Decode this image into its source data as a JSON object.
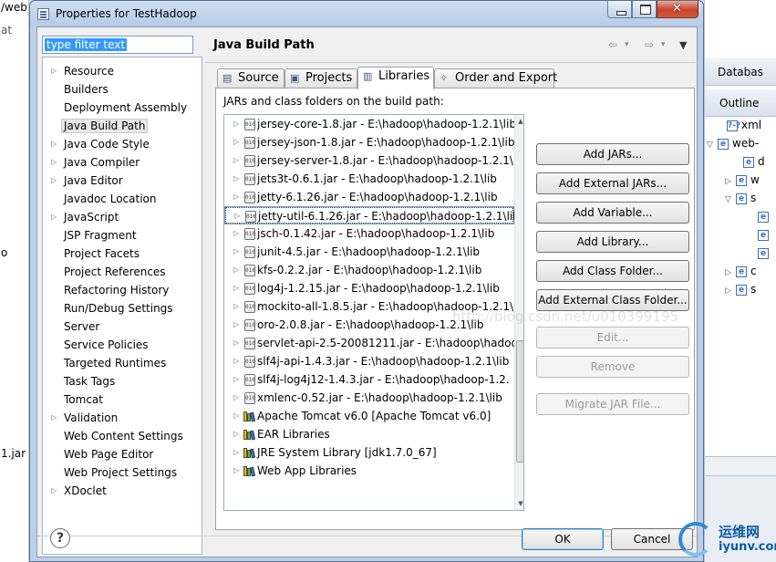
{
  "background": {
    "left_texts": [
      "/web",
      "at",
      "o",
      "1.jar"
    ],
    "right": {
      "databases_tab": "Databas",
      "outline_tab": "Outline",
      "outline_rows": [
        {
          "twisty": "",
          "icon": "?-?",
          "label": "xml"
        },
        {
          "twisty": "▽",
          "icon": "e",
          "label": "web-"
        },
        {
          "twisty": "",
          "icon": "e",
          "label": "d"
        },
        {
          "twisty": "▷",
          "icon": "e",
          "label": "w"
        },
        {
          "twisty": "▽",
          "icon": "e",
          "label": "s"
        },
        {
          "twisty": "",
          "icon": "e",
          "label": ""
        },
        {
          "twisty": "",
          "icon": "e",
          "label": ""
        },
        {
          "twisty": "",
          "icon": "e",
          "label": ""
        },
        {
          "twisty": "▷",
          "icon": "e",
          "label": "c"
        },
        {
          "twisty": "▷",
          "icon": "e",
          "label": "s"
        }
      ]
    }
  },
  "dialog": {
    "title": "Properties for TestHadoop",
    "filter": {
      "value": "type filter text"
    },
    "tree": [
      {
        "label": "Resource",
        "expandable": true
      },
      {
        "label": "Builders",
        "expandable": false
      },
      {
        "label": "Deployment Assembly",
        "expandable": false
      },
      {
        "label": "Java Build Path",
        "expandable": false,
        "selected": true
      },
      {
        "label": "Java Code Style",
        "expandable": true
      },
      {
        "label": "Java Compiler",
        "expandable": true
      },
      {
        "label": "Java Editor",
        "expandable": true
      },
      {
        "label": "Javadoc Location",
        "expandable": false
      },
      {
        "label": "JavaScript",
        "expandable": true
      },
      {
        "label": "JSP Fragment",
        "expandable": false
      },
      {
        "label": "Project Facets",
        "expandable": false
      },
      {
        "label": "Project References",
        "expandable": false
      },
      {
        "label": "Refactoring History",
        "expandable": false
      },
      {
        "label": "Run/Debug Settings",
        "expandable": false
      },
      {
        "label": "Server",
        "expandable": false
      },
      {
        "label": "Service Policies",
        "expandable": false
      },
      {
        "label": "Targeted Runtimes",
        "expandable": false
      },
      {
        "label": "Task Tags",
        "expandable": false
      },
      {
        "label": "Tomcat",
        "expandable": false
      },
      {
        "label": "Validation",
        "expandable": true
      },
      {
        "label": "Web Content Settings",
        "expandable": false
      },
      {
        "label": "Web Page Editor",
        "expandable": false
      },
      {
        "label": "Web Project Settings",
        "expandable": false
      },
      {
        "label": "XDoclet",
        "expandable": true
      }
    ],
    "page_title": "Java Build Path",
    "nav_icons": {
      "back": "⇦",
      "back_menu": "▾",
      "forward": "⇨",
      "forward_menu": "▾",
      "view_menu": "▼"
    },
    "tabs": [
      {
        "label": "Source",
        "icon": "source-folder-icon",
        "glyph": "▤"
      },
      {
        "label": "Projects",
        "icon": "projects-icon",
        "glyph": "▣"
      },
      {
        "label": "Libraries",
        "icon": "libraries-icon",
        "glyph": "▥",
        "active": true
      },
      {
        "label": "Order and Export",
        "icon": "order-export-icon",
        "glyph": "✧"
      }
    ],
    "libraries": {
      "caption": "JARs and class folders on the build path:",
      "entries": [
        {
          "label": "jersey-core-1.8.jar - E:\\hadoop\\hadoop-1.2.1\\lib",
          "kind": "jar"
        },
        {
          "label": "jersey-json-1.8.jar - E:\\hadoop\\hadoop-1.2.1\\lib",
          "kind": "jar"
        },
        {
          "label": "jersey-server-1.8.jar - E:\\hadoop\\hadoop-1.2.1\\",
          "kind": "jar"
        },
        {
          "label": "jets3t-0.6.1.jar - E:\\hadoop\\hadoop-1.2.1\\lib",
          "kind": "jar"
        },
        {
          "label": "jetty-6.1.26.jar - E:\\hadoop\\hadoop-1.2.1\\lib",
          "kind": "jar"
        },
        {
          "label": "jetty-util-6.1.26.jar - E:\\hadoop\\hadoop-1.2.1\\lib",
          "kind": "jar",
          "focused": true
        },
        {
          "label": "jsch-0.1.42.jar - E:\\hadoop\\hadoop-1.2.1\\lib",
          "kind": "jar"
        },
        {
          "label": "junit-4.5.jar - E:\\hadoop\\hadoop-1.2.1\\lib",
          "kind": "jar"
        },
        {
          "label": "kfs-0.2.2.jar - E:\\hadoop\\hadoop-1.2.1\\lib",
          "kind": "jar"
        },
        {
          "label": "log4j-1.2.15.jar - E:\\hadoop\\hadoop-1.2.1\\lib",
          "kind": "jar"
        },
        {
          "label": "mockito-all-1.8.5.jar - E:\\hadoop\\hadoop-1.2.1\\",
          "kind": "jar"
        },
        {
          "label": "oro-2.0.8.jar - E:\\hadoop\\hadoop-1.2.1\\lib",
          "kind": "jar"
        },
        {
          "label": "servlet-api-2.5-20081211.jar - E:\\hadoop\\hadoo",
          "kind": "jar"
        },
        {
          "label": "slf4j-api-1.4.3.jar - E:\\hadoop\\hadoop-1.2.1\\lib",
          "kind": "jar"
        },
        {
          "label": "slf4j-log4j12-1.4.3.jar - E:\\hadoop\\hadoop-1.2.",
          "kind": "jar"
        },
        {
          "label": "xmlenc-0.52.jar - E:\\hadoop\\hadoop-1.2.1\\lib",
          "kind": "jar"
        },
        {
          "label": "Apache Tomcat v6.0 [Apache Tomcat v6.0]",
          "kind": "lib"
        },
        {
          "label": "EAR Libraries",
          "kind": "lib"
        },
        {
          "label": "JRE System Library [jdk1.7.0_67]",
          "kind": "lib"
        },
        {
          "label": "Web App Libraries",
          "kind": "lib"
        }
      ],
      "jar_glyph": "010",
      "buttons": [
        {
          "label": "Add JARs...",
          "enabled": true
        },
        {
          "label": "Add External JARs...",
          "enabled": true
        },
        {
          "label": "Add Variable...",
          "enabled": true
        },
        {
          "label": "Add Library...",
          "enabled": true
        },
        {
          "label": "Add Class Folder...",
          "enabled": true
        },
        {
          "label": "Add External Class Folder...",
          "enabled": true
        },
        {
          "label": "Edit...",
          "enabled": false
        },
        {
          "label": "Remove",
          "enabled": false
        },
        {
          "label": "Migrate JAR File...",
          "enabled": false
        }
      ]
    },
    "help_glyph": "?",
    "ok_label": "OK",
    "cancel_label": "Cancel"
  },
  "watermark": "http://blog.csdn.net/u010399195",
  "logo": {
    "line1": "运维网",
    "line2": "iyunv.com"
  }
}
